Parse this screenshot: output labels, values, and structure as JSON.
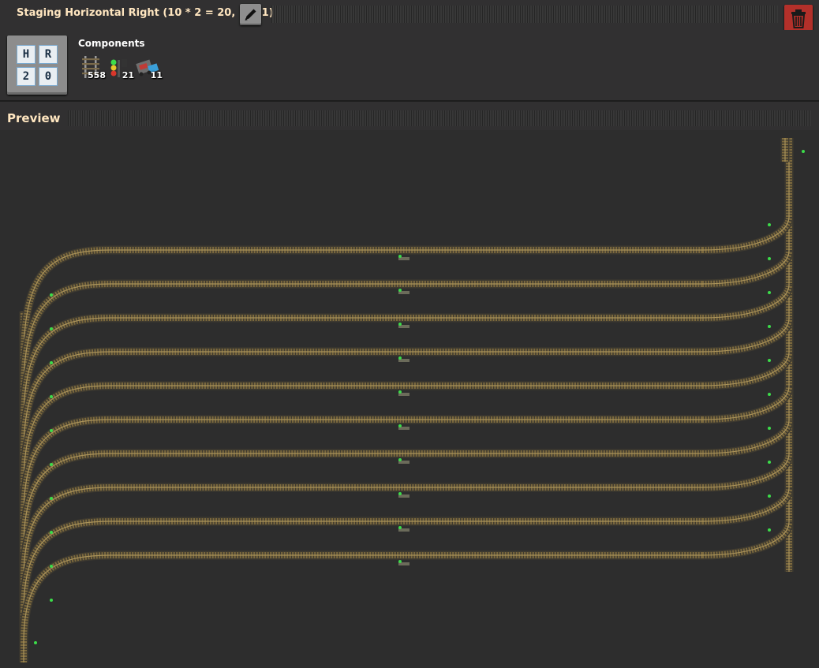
{
  "window": {
    "title": "Staging Horizontal Right (10 * 2 = 20, 1-4-1)"
  },
  "icons": {
    "edit": "pencil-icon",
    "delete": "trash-icon"
  },
  "blueprint_icon": {
    "cells": [
      "H",
      "R",
      "2",
      "0"
    ]
  },
  "components": {
    "label": "Components",
    "items": [
      {
        "icon": "rail-icon",
        "count": "558"
      },
      {
        "icon": "rail-signal-icon",
        "count": "21"
      },
      {
        "icon": "train-stop-icon",
        "count": "11"
      }
    ]
  },
  "preview": {
    "label": "Preview",
    "staging_lanes": 10
  },
  "colors": {
    "title_text": "#ffe6c0",
    "background": "#313031",
    "delete_button": "#b3302a",
    "rail": "#7d6a3e",
    "rail_edge": "#a9925a",
    "signal": "#3cdc4a"
  }
}
